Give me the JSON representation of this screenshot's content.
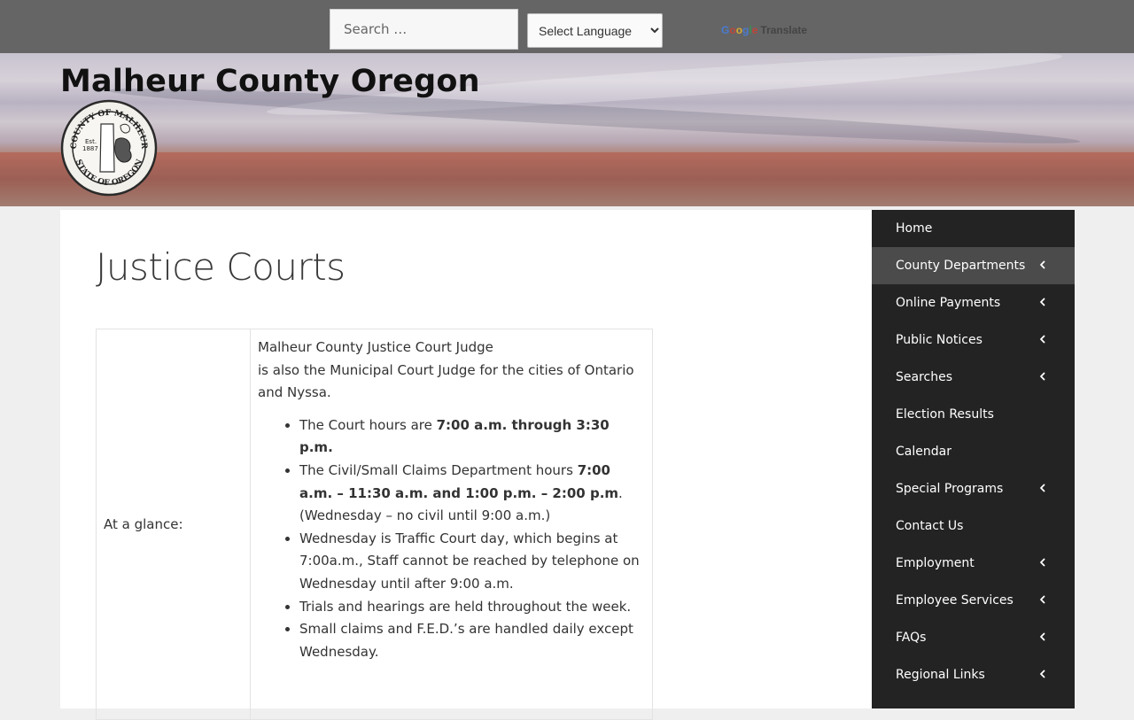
{
  "topbar": {
    "search_placeholder": "Search …",
    "language_select": "Select Language",
    "powered_by": "Google",
    "translate_label": "Translate"
  },
  "header": {
    "site_title": "Malheur County Oregon",
    "seal_alt": "County of Malheur State of Oregon seal",
    "seal_text_top": "COUNTY OF MALHEUR",
    "seal_text_bottom": "STATE OF OREGON",
    "seal_est": "Est.",
    "seal_year": "1887"
  },
  "page": {
    "title": "Justice Courts",
    "table": {
      "label": "At a glance:",
      "intro_line1": "Malheur County Justice Court Judge",
      "intro_line2": "is also the Municipal Court Judge for the cities of Ontario and Nyssa.",
      "items": [
        {
          "pre": "The Court hours are ",
          "bold": "7:00 a.m. through 3:30 p.m.",
          "post": ""
        },
        {
          "pre": "The Civil/Small Claims Department hours ",
          "bold": "7:00 a.m. – 11:30 a.m. and 1:00 p.m. – 2:00 p.m",
          "post": ". (Wednesday – no civil until 9:00 a.m.)"
        },
        {
          "pre": "Wednesday is Traffic Court day, which begins at 7:00a.m., Staff cannot be reached by telephone on Wednesday until after 9:00 a.m.",
          "bold": "",
          "post": ""
        },
        {
          "pre": "Trials and hearings are held throughout the week.",
          "bold": "",
          "post": ""
        },
        {
          "pre": "Small claims and F.E.D.’s are handled daily except Wednesday.",
          "bold": "",
          "post": ""
        }
      ]
    }
  },
  "sidebar": {
    "items": [
      {
        "label": "Home",
        "submenu": false,
        "active": false
      },
      {
        "label": "County Departments",
        "submenu": true,
        "active": true
      },
      {
        "label": "Online Payments",
        "submenu": true,
        "active": false
      },
      {
        "label": "Public Notices",
        "submenu": true,
        "active": false
      },
      {
        "label": "Searches",
        "submenu": true,
        "active": false
      },
      {
        "label": "Election Results",
        "submenu": false,
        "active": false
      },
      {
        "label": "Calendar",
        "submenu": false,
        "active": false
      },
      {
        "label": "Special Programs",
        "submenu": true,
        "active": false
      },
      {
        "label": "Contact Us",
        "submenu": false,
        "active": false
      },
      {
        "label": "Employment",
        "submenu": true,
        "active": false
      },
      {
        "label": "Employee Services",
        "submenu": true,
        "active": false
      },
      {
        "label": "FAQs",
        "submenu": true,
        "active": false
      },
      {
        "label": "Regional Links",
        "submenu": true,
        "active": false
      }
    ]
  },
  "colors": {
    "topbar_bg": "#656565",
    "sidebar_bg": "#232323",
    "sidebar_active_bg": "#4b4b4b",
    "page_bg": "#efefef"
  }
}
